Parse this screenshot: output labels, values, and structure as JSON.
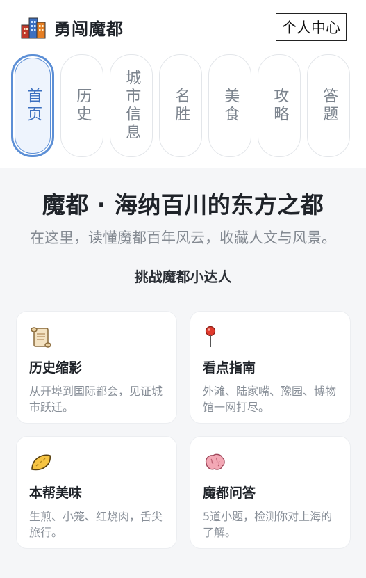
{
  "header": {
    "brand_title": "勇闯魔都",
    "logo_icon": "city-buildings-icon",
    "user_button": "个人中心"
  },
  "nav": {
    "items": [
      {
        "label": "首页",
        "active": true
      },
      {
        "label": "历史",
        "active": false
      },
      {
        "label": "城市信息",
        "active": false
      },
      {
        "label": "名胜",
        "active": false
      },
      {
        "label": "美食",
        "active": false
      },
      {
        "label": "攻略",
        "active": false
      },
      {
        "label": "答题",
        "active": false
      }
    ]
  },
  "hero": {
    "title": "魔都 · 海纳百川的东方之都",
    "subtitle": "在这里，读懂魔都百年风云，收藏人文与风景。"
  },
  "challenge": "挑战魔都小达人",
  "cards": [
    {
      "icon": "scroll-icon",
      "title": "历史缩影",
      "desc": "从开埠到国际都会，见证城市跃迁。"
    },
    {
      "icon": "pushpin-icon",
      "title": "看点指南",
      "desc": "外滩、陆家嘴、豫园、博物馆一网打尽。"
    },
    {
      "icon": "dumpling-icon",
      "title": "本帮美味",
      "desc": "生煎、小笼、红烧肉，舌尖旅行。"
    },
    {
      "icon": "brain-icon",
      "title": "魔都问答",
      "desc": "5道小题，检测你对上海的了解。"
    }
  ],
  "colors": {
    "accent": "#5c8fd6",
    "background": "#f5f6f8"
  }
}
